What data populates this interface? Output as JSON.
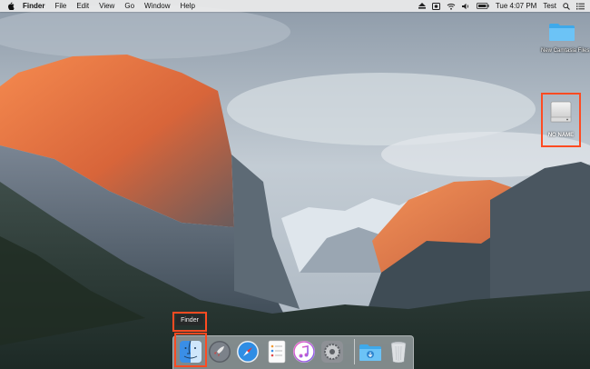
{
  "menubar": {
    "app_name": "Finder",
    "menus": [
      "File",
      "Edit",
      "View",
      "Go",
      "Window",
      "Help"
    ],
    "clock": "Tue 4:07 PM",
    "user": "Test"
  },
  "desktop": {
    "folder_label": "New Camtasia Files",
    "drive_label": "NO NAME"
  },
  "dock": {
    "tooltip": "Finder",
    "items": [
      "finder",
      "launchpad",
      "safari",
      "reminders",
      "itunes",
      "system-preferences",
      "downloads",
      "trash"
    ]
  },
  "colors": {
    "highlight": "#ff4b22",
    "menubar_bg": "#ececec"
  }
}
